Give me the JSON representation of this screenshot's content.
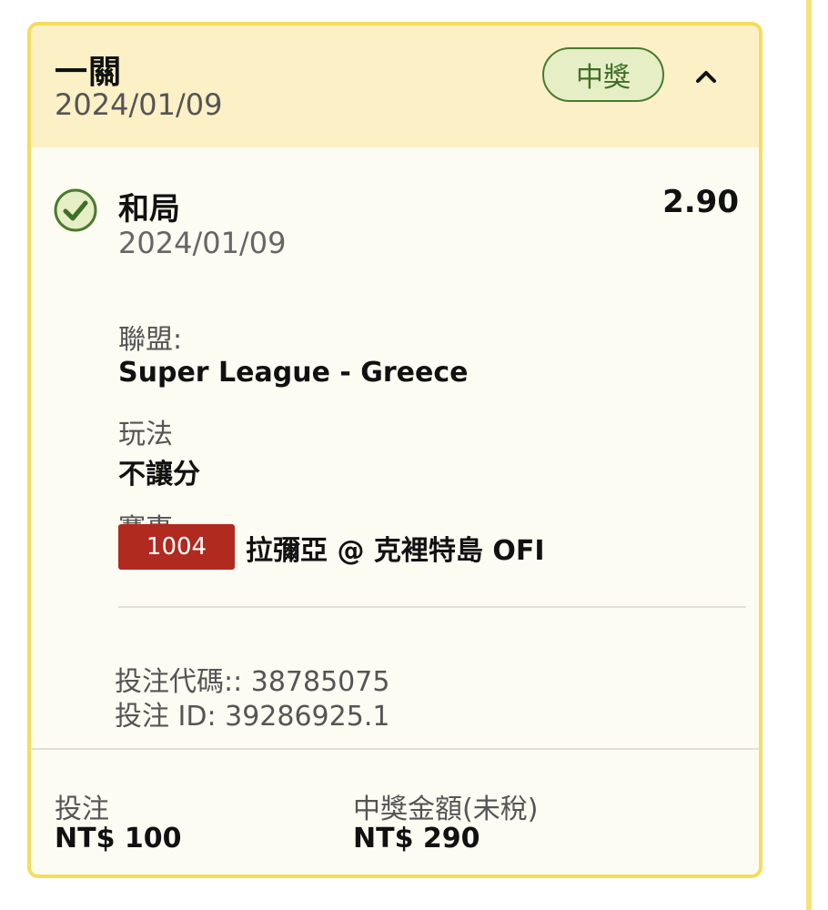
{
  "bet": {
    "type_label": "一關",
    "date": "2024/01/09",
    "status": "中獎"
  },
  "selection": {
    "name": "和局",
    "date": "2024/01/09",
    "odds": "2.90",
    "league_label": "聯盟:",
    "league_value": "Super League - Greece",
    "market_label": "玩法",
    "market_value": "不讓分",
    "event_label": "賽事",
    "event_id": "1004",
    "event_name": "拉彌亞 @ 克裡特島 OFI"
  },
  "meta": {
    "bet_code": "投注代碼:: 38785075",
    "bet_id": "投注 ID: 39286925.1"
  },
  "footer": {
    "stake_label": "投注",
    "stake_value": "NT$ 100",
    "payout_label": "中獎金額(未稅)",
    "payout_value": "NT$ 290"
  },
  "icons": {
    "status_check": "check-circle-icon",
    "collapse": "chevron-up-icon"
  },
  "colors": {
    "card_border": "#f4dd5d",
    "header_bg": "#fbf0c6",
    "card_bg": "#fdfcf3",
    "win_green": "#4a7a30",
    "event_red": "#b02a20"
  }
}
